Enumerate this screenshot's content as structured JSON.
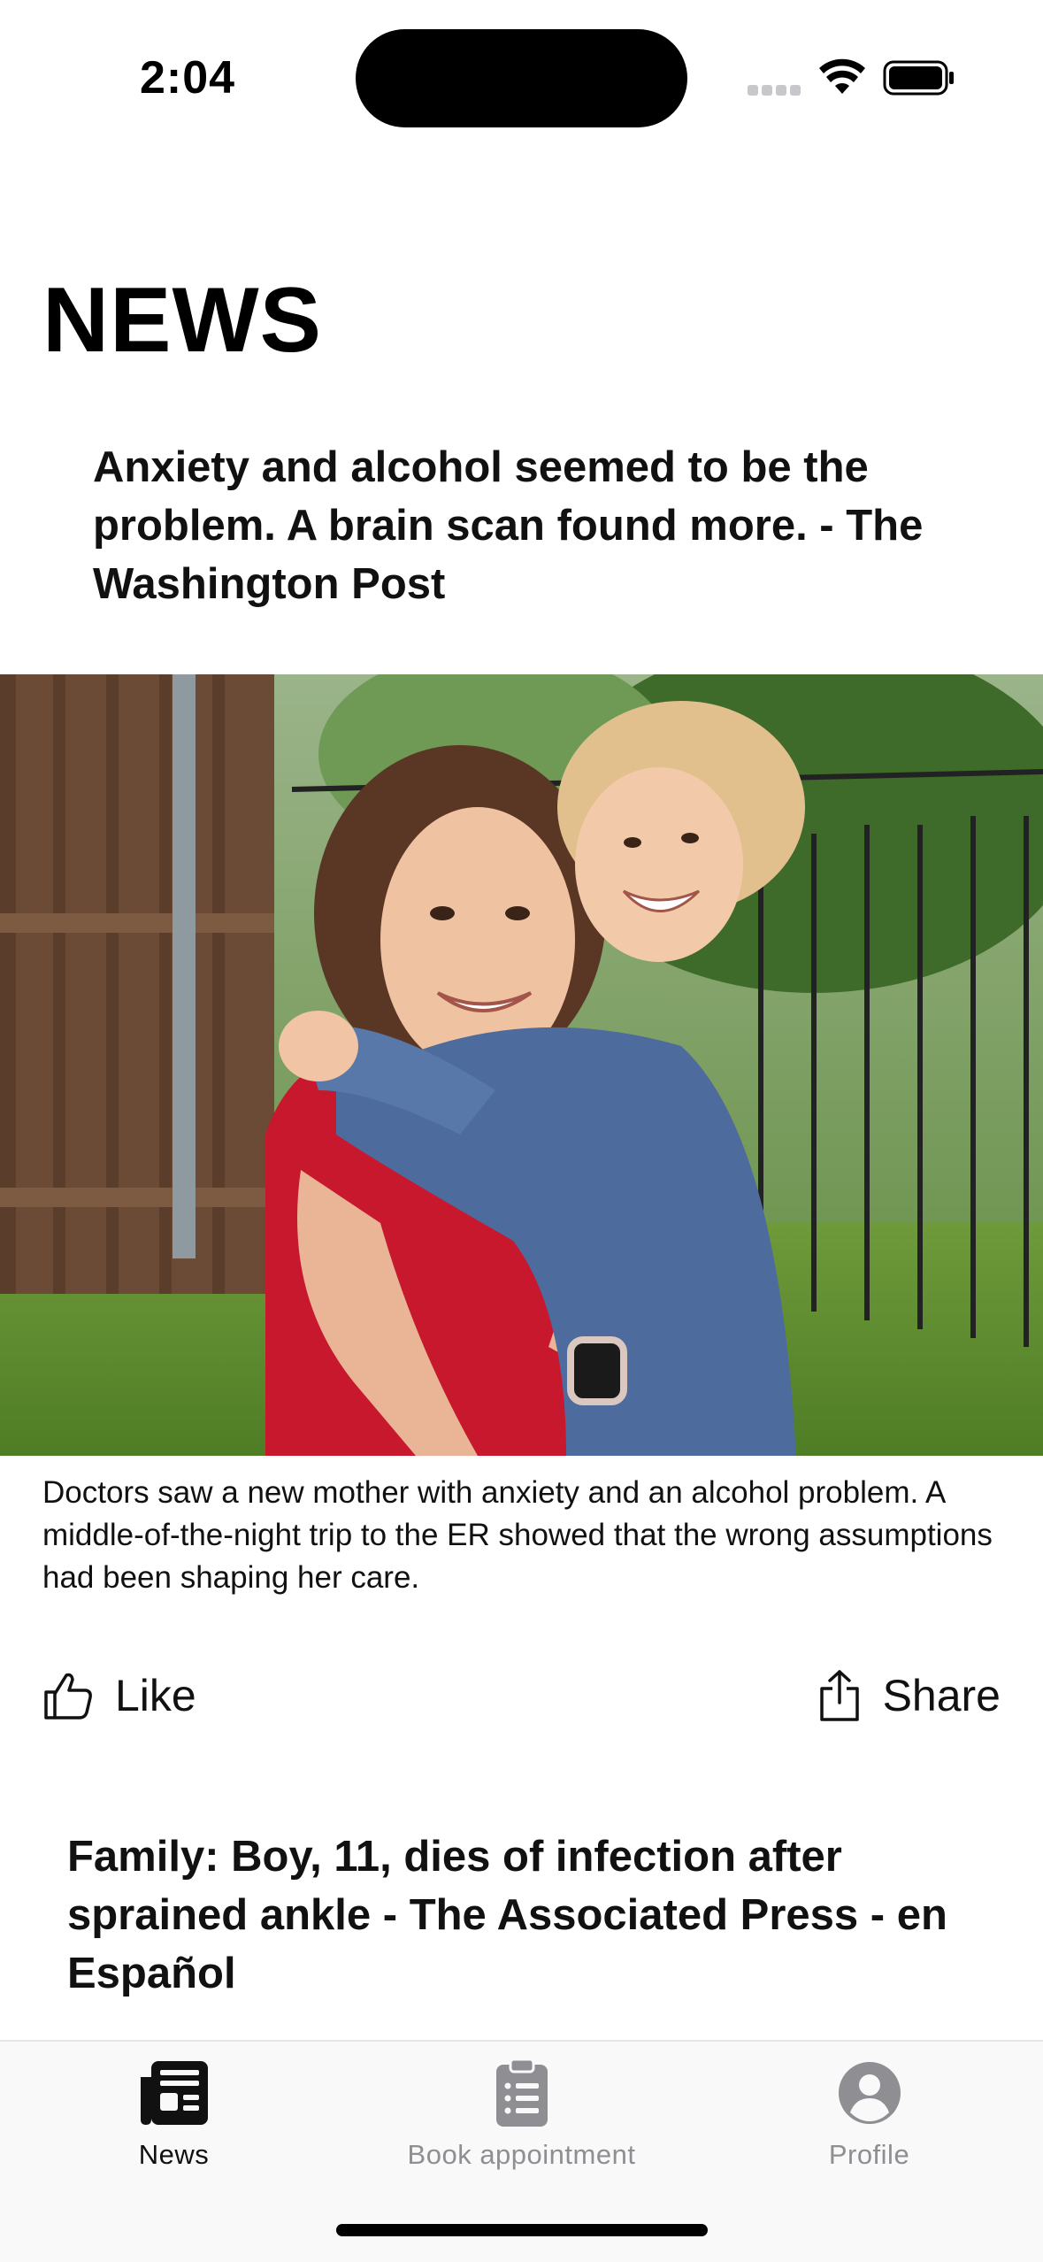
{
  "status_bar": {
    "time": "2:04"
  },
  "header": {
    "title": "NEWS"
  },
  "articles": [
    {
      "title": "Anxiety and alcohol seemed to be the problem. A brain scan found more. - The Washington Post",
      "summary": "Doctors saw a new mother with anxiety and an alcohol problem. A middle-of-the-night trip to the ER showed that the wrong assumptions had been shaping her care.",
      "image_icon": "photo-mother-hugging-child",
      "actions": {
        "like_label": "Like",
        "like_icon": "thumbs-up-icon",
        "share_label": "Share",
        "share_icon": "share-icon"
      }
    },
    {
      "title": "Family: Boy, 11, dies of infection after sprained ankle - The Associated Press - en Español"
    }
  ],
  "tab_bar": {
    "tabs": [
      {
        "label": "News",
        "icon": "newspaper-icon",
        "active": true
      },
      {
        "label": "Book appointment",
        "icon": "clipboard-icon",
        "active": false
      },
      {
        "label": "Profile",
        "icon": "person-circle-icon",
        "active": false
      }
    ]
  },
  "colors": {
    "active_tab": "#111111",
    "inactive_tab": "#8e8e93",
    "tab_bar_bg": "#f9f9f9"
  }
}
